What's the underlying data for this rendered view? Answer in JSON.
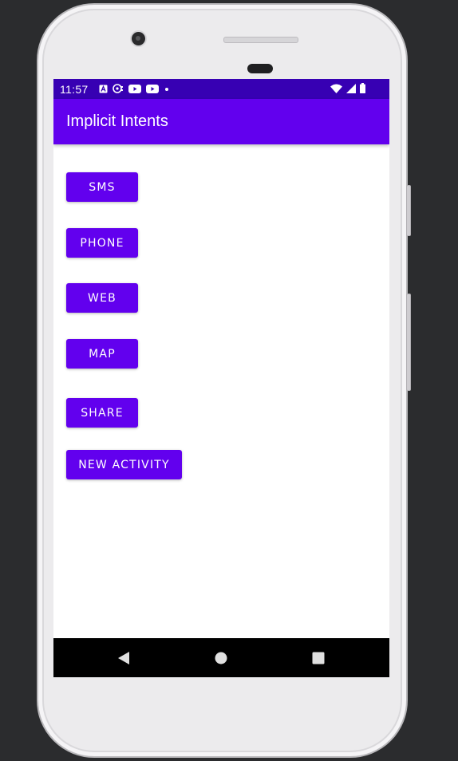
{
  "status_bar": {
    "time": "11:57",
    "left_icons": [
      "a-icon",
      "chat-icon",
      "youtube-icon",
      "youtube-icon",
      "dot-icon"
    ],
    "right_icons": [
      "wifi-icon",
      "signal-icon",
      "battery-icon"
    ],
    "color": "#3700b3"
  },
  "app_bar": {
    "title": "Implicit Intents",
    "color": "#6200ee"
  },
  "buttons": [
    {
      "label": "SMS"
    },
    {
      "label": "PHONE"
    },
    {
      "label": "WEB"
    },
    {
      "label": "MAP"
    },
    {
      "label": "SHARE"
    },
    {
      "label": "NEW ACTIVITY"
    }
  ],
  "nav_bar": {
    "icons": [
      "back-icon",
      "home-icon",
      "recents-icon"
    ]
  },
  "colors": {
    "primary": "#6200ee",
    "primary_dark": "#3700b3",
    "on_primary": "#ffffff",
    "background": "#ffffff",
    "device_frame": "#ecebed",
    "desktop_background": "#2b2c2e"
  }
}
